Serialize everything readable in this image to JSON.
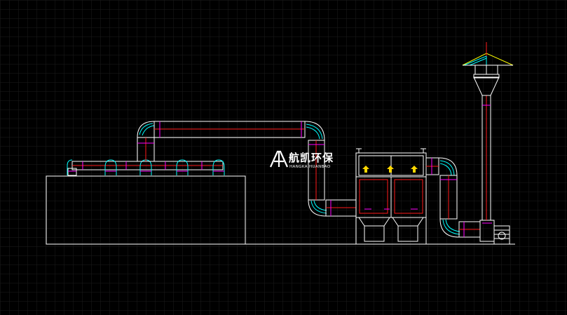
{
  "logo": {
    "name_cn": "航凯环保",
    "name_en": "HANGKAIHUANBAO",
    "icon": "hk-monogram-icon"
  },
  "colors": {
    "background": "#000000",
    "grid": "#1c1c1c",
    "outline": "#ffffff",
    "duct_accent": "#ff1a1a",
    "flange": "#ff00ff",
    "elbow": "#00ffff",
    "arrow": "#ffd800",
    "cap": "#ffff00"
  }
}
